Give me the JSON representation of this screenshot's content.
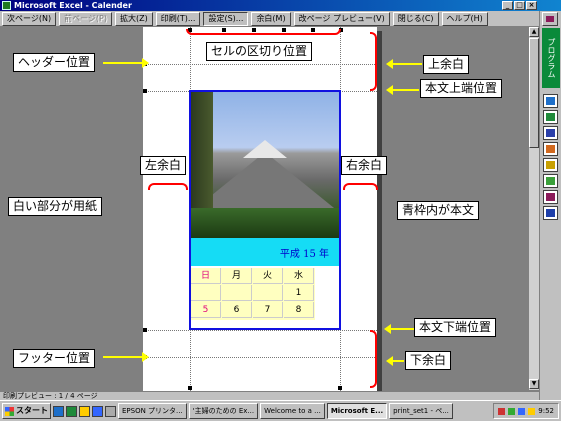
{
  "window": {
    "title": "Microsoft Excel - Calender"
  },
  "toolbar": {
    "buttons": [
      "次ページ(N)",
      "前ページ(P)",
      "拡大(Z)",
      "印刷(T)...",
      "設定(S)...",
      "余白(M)",
      "改ページ プレビュー(V)",
      "閉じる(C)",
      "ヘルプ(H)"
    ]
  },
  "rightbar": {
    "green_label": "プログラム"
  },
  "body_content": {
    "era": "平成 15 年",
    "calendar": {
      "headers": [
        "日",
        "月",
        "火",
        "水"
      ],
      "rows": [
        [
          "",
          "",
          "",
          "1"
        ],
        [
          "5",
          "6",
          "7",
          "8"
        ]
      ]
    }
  },
  "annotations": {
    "cell_divider": "セルの区切り位置",
    "header_pos": "ヘッダー位置",
    "top_margin": "上余白",
    "body_top": "本文上端位置",
    "left_margin": "左余白",
    "right_margin": "右余白",
    "paper": "白い部分が用紙",
    "body": "青枠内が本文",
    "body_bottom": "本文下端位置",
    "footer_pos": "フッター位置",
    "bottom_margin": "下余白"
  },
  "status": {
    "text": "印刷プレビュー : 1 / 4 ページ"
  },
  "taskbar": {
    "start": "スタート",
    "tasks": [
      "EPSON プリンタ...",
      "'主婦のための Ex...",
      "Welcome to a ...",
      "Microsoft E...",
      "print_set1 - ペ..."
    ],
    "active_task_index": 3,
    "clock": "9:52"
  },
  "colors": {
    "body_frame": "#1010e0",
    "arrow": "#ffff00",
    "brace": "#ff0000",
    "era_band": "#15dcf5",
    "calendar_bg": "#ffffc0"
  }
}
